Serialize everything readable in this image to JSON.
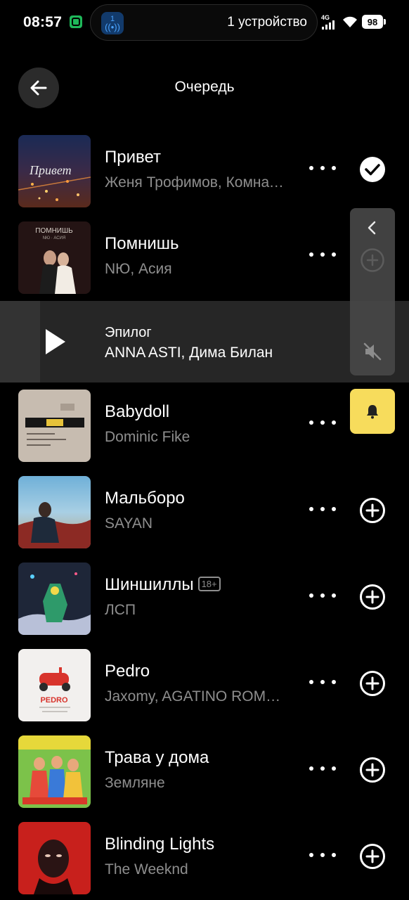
{
  "status_bar": {
    "time": "08:57",
    "island_badge": "1",
    "island_text": "1 устройство",
    "network": "4G",
    "battery": "98"
  },
  "header": {
    "title": "Очередь"
  },
  "current": {
    "title": "Эпилог",
    "artist": "ANNA ASTI, Дима Билан"
  },
  "tracks": [
    {
      "title": "Привет",
      "artist": "Женя Трофимов, Комната культуры",
      "action": "check-icon"
    },
    {
      "title": "Помнишь",
      "artist": "NЮ, Асия",
      "action": "plus-circle-icon"
    },
    {
      "title": "Babydoll",
      "artist": "Dominic Fike",
      "action": "plus-circle-icon"
    },
    {
      "title": "Мальборо",
      "artist": "SAYAN",
      "action": "plus-circle-icon"
    },
    {
      "title": "Шиншиллы",
      "artist": "ЛСП",
      "badge": "18+",
      "action": "plus-circle-icon"
    },
    {
      "title": "Pedro",
      "artist": "Jaxomy, AGATINO ROMERO, Raffaella Carrà",
      "action": "plus-circle-icon"
    },
    {
      "title": "Трава у дома",
      "artist": "Земляне",
      "action": "plus-circle-icon"
    },
    {
      "title": "Blinding Lights",
      "artist": "The Weeknd",
      "action": "plus-circle-icon"
    }
  ],
  "covers": {
    "privet_text": "Привет",
    "pomnish_text": "ПОМНИШЬ",
    "pomnish_sub": "NЮ · АСИЯ",
    "pedro_text": "PEDRO"
  },
  "colors": {
    "background": "#000000",
    "current_row": "#262626",
    "muted_text": "#8e8e8e",
    "bell": "#f7dc5c"
  }
}
